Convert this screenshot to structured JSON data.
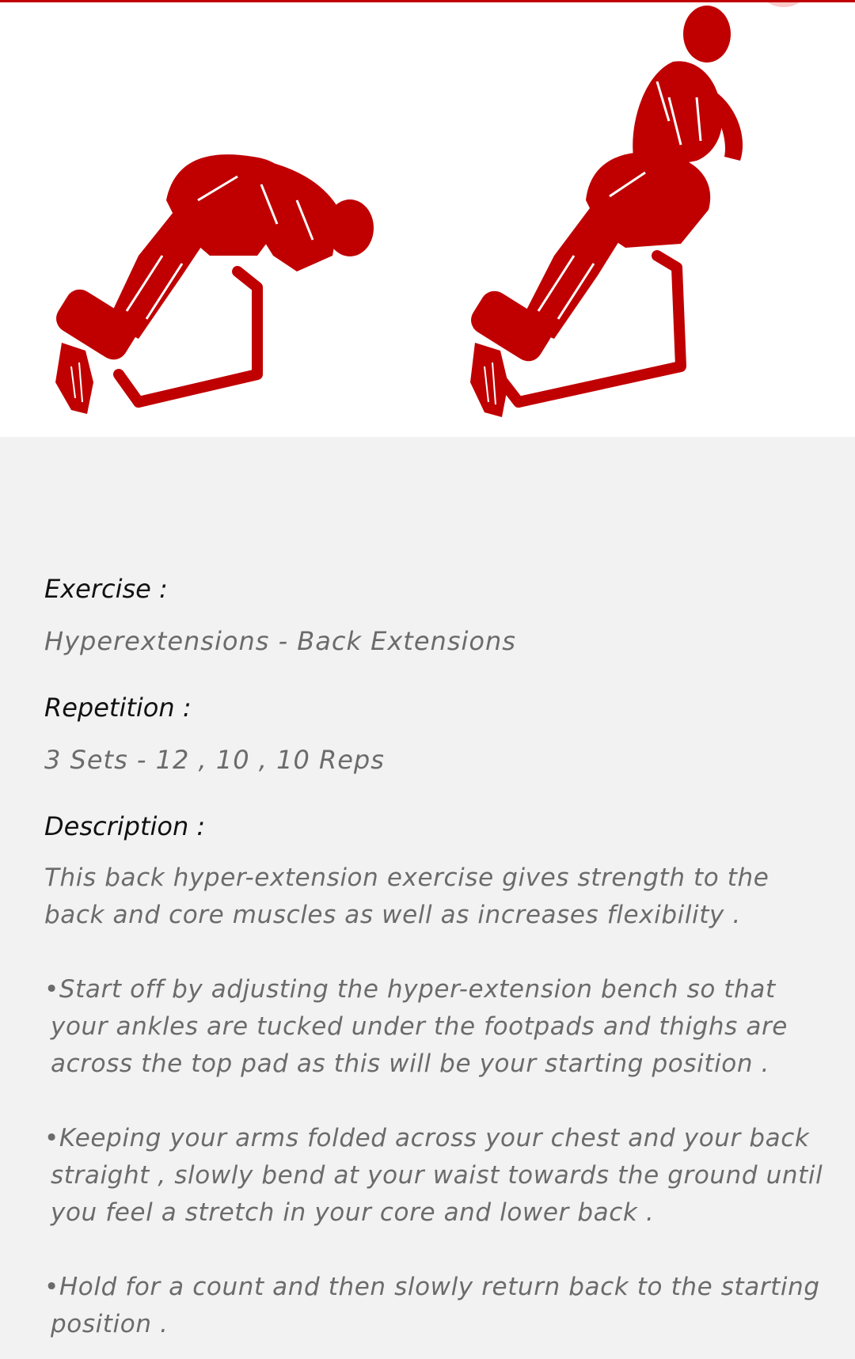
{
  "exercise_label": "Exercise :",
  "exercise_value": "Hyperextensions - Back Extensions",
  "repetition_label": "Repetition :",
  "repetition_value": "3 Sets - 12 , 10 , 10 Reps",
  "description_label": "Description :",
  "description_paragraphs": [
    "This back hyper-extension exercise gives strength to the back and core muscles as well as increases flexibility .",
    "•Start off by adjusting the hyper-extension bench so that your ankles are tucked under the footpads and thighs are across the top pad as this will be your starting position .",
    "•Keeping your arms folded across your chest and your back straight , slowly bend at your waist towards the ground until you feel a stretch in your core and lower back .",
    "•Hold for a count and then slowly return back to the starting position ."
  ],
  "colors": {
    "accent": "#c00000",
    "background": "#f2f2f2",
    "label": "#111111",
    "value": "#6b6b6b"
  },
  "illustrations": [
    "hyperextension-start-figure-icon",
    "hyperextension-end-figure-icon"
  ]
}
